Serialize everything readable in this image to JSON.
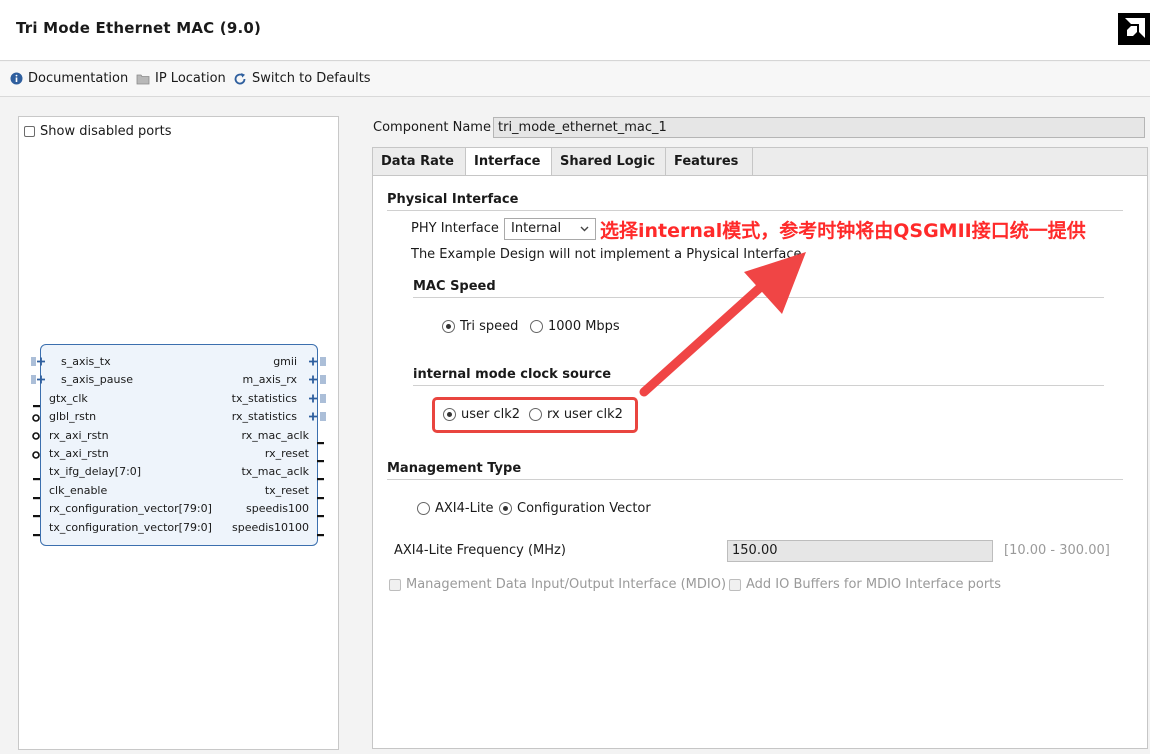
{
  "window": {
    "title": "Tri Mode Ethernet MAC (9.0)"
  },
  "toolbar": {
    "documentation": "Documentation",
    "ip_location": "IP Location",
    "switch_defaults": "Switch to Defaults"
  },
  "left": {
    "show_disabled": "Show disabled ports",
    "ports_left": [
      "s_axis_tx",
      "s_axis_pause",
      "gtx_clk",
      "glbl_rstn",
      "rx_axi_rstn",
      "tx_axi_rstn",
      "tx_ifg_delay[7:0]",
      "clk_enable",
      "rx_configuration_vector[79:0]",
      "tx_configuration_vector[79:0]"
    ],
    "ports_right": [
      "gmii",
      "m_axis_rx",
      "tx_statistics",
      "rx_statistics",
      "rx_mac_aclk",
      "rx_reset",
      "tx_mac_aclk",
      "tx_reset",
      "speedis100",
      "speedis10100"
    ]
  },
  "component": {
    "label": "Component Name",
    "value": "tri_mode_ethernet_mac_1"
  },
  "tabs": [
    "Data Rate",
    "Interface",
    "Shared Logic",
    "Features"
  ],
  "active_tab": "Interface",
  "physical": {
    "title": "Physical Interface",
    "phy_label": "PHY Interface",
    "phy_value": "Internal",
    "note": "The Example Design will not implement a Physical Interface"
  },
  "mac_speed": {
    "title": "MAC Speed",
    "opt1": "Tri speed",
    "opt2": "1000 Mbps",
    "selected": "Tri speed"
  },
  "clock_source": {
    "title": "internal mode clock source",
    "opt1": "user clk2",
    "opt2": "rx user clk2",
    "selected": "user clk2"
  },
  "management": {
    "title": "Management Type",
    "opt1": "AXI4-Lite",
    "opt2": "Configuration Vector",
    "selected": "Configuration Vector",
    "freq_label": "AXI4-Lite Frequency (MHz)",
    "freq_value": "150.00",
    "freq_range": "[10.00 - 300.00]",
    "mdio_label": "Management Data Input/Output Interface (MDIO)",
    "iobuf_label": "Add IO Buffers for MDIO Interface ports"
  },
  "annotation": {
    "text": "选择internal模式，参考时钟将由QSGMII接口统一提供",
    "color": "#ff2a2a"
  },
  "colors": {
    "accent": "#3b6fae",
    "highlight": "#e9453f"
  }
}
